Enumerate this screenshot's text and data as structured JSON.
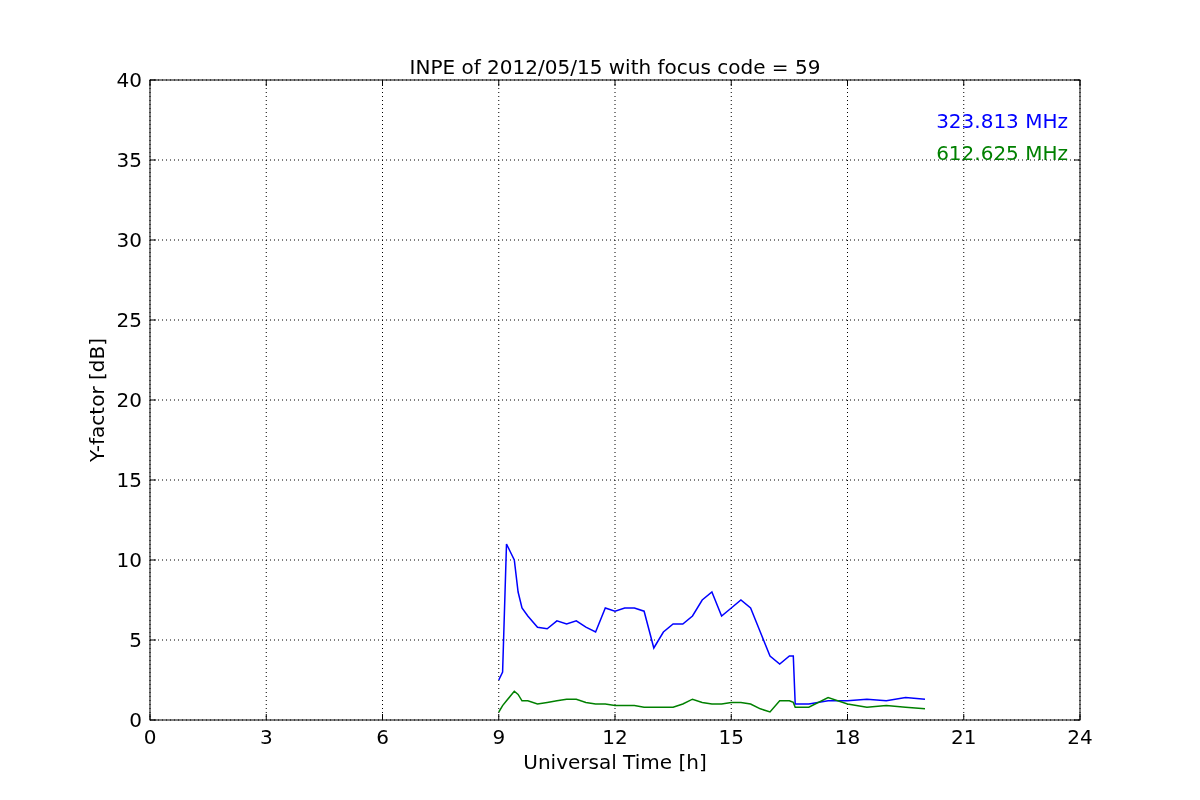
{
  "chart_data": {
    "type": "line",
    "title": "INPE of 2012/05/15 with focus code = 59",
    "xlabel": "Universal Time [h]",
    "ylabel": "Y-factor [dB]",
    "x": [
      9,
      9.1,
      9.2,
      9.3,
      9.4,
      9.5,
      9.6,
      9.75,
      10,
      10.25,
      10.5,
      10.75,
      11,
      11.25,
      11.5,
      11.75,
      12,
      12.25,
      12.5,
      12.75,
      13,
      13.25,
      13.5,
      13.75,
      14,
      14.25,
      14.5,
      14.75,
      15,
      15.25,
      15.5,
      15.75,
      16,
      16.25,
      16.5,
      16.6,
      16.65,
      17,
      17.5,
      18,
      18.5,
      19,
      19.5,
      20
    ],
    "series": [
      {
        "name": "323.813 MHz",
        "color": "#0000ff",
        "values": [
          2.5,
          3,
          11,
          10.5,
          10,
          8,
          7,
          6.5,
          5.8,
          5.7,
          6.2,
          6,
          6.2,
          5.8,
          5.5,
          7,
          6.8,
          7,
          7,
          6.8,
          4.5,
          5.5,
          6,
          6,
          6.5,
          7.5,
          8,
          6.5,
          7,
          7.5,
          7,
          5.5,
          4,
          3.5,
          4,
          4,
          1,
          1,
          1.2,
          1.2,
          1.3,
          1.2,
          1.4,
          1.3
        ]
      },
      {
        "name": "612.625 MHz",
        "color": "#008000",
        "values": [
          0.5,
          0.9,
          1.2,
          1.5,
          1.8,
          1.6,
          1.2,
          1.2,
          1,
          1.1,
          1.2,
          1.3,
          1.3,
          1.1,
          1,
          1,
          0.9,
          0.9,
          0.9,
          0.8,
          0.8,
          0.8,
          0.8,
          1,
          1.3,
          1.1,
          1,
          1,
          1.1,
          1.1,
          1,
          0.7,
          0.5,
          1.2,
          1.2,
          1.1,
          0.8,
          0.8,
          1.4,
          1,
          0.8,
          0.9,
          0.8,
          0.7
        ]
      }
    ],
    "grid": true,
    "xlim": [
      0,
      24
    ],
    "ylim": [
      0,
      40
    ],
    "xticks": [
      0,
      3,
      6,
      9,
      12,
      15,
      18,
      21,
      24
    ],
    "yticks": [
      0,
      5,
      10,
      15,
      20,
      25,
      30,
      35,
      40
    ]
  }
}
